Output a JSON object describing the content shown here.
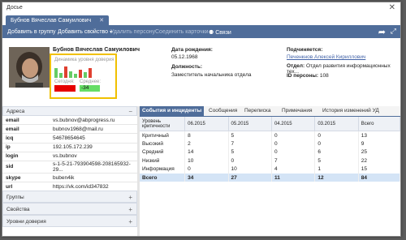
{
  "window": {
    "title": "Досье"
  },
  "tab": {
    "label": "Бубнов Вячеслав Самуилович"
  },
  "toolbar": {
    "add_group": "Добавить в группу",
    "add_property": "Добавить свойство",
    "delete_person": "Удалить персону",
    "merge_cards": "Соединить карточки",
    "links": "Связи"
  },
  "profile": {
    "name": "Бубнов Вячеслав Самуилович",
    "trust": {
      "title": "Динамика уровня доверия",
      "today_label": "Сегодня:",
      "avg_label": "Среднее:",
      "avg_value": "-34",
      "today_color": "#e60000",
      "avg_color": "#66dd66"
    },
    "birth_label": "Дата рождения:",
    "birth_value": "05.12.1968",
    "position_label": "Должность:",
    "position_value": "Заместитель начальника отдела",
    "subordinate_label": "Подчиняется:",
    "subordinate_value": "Печенкнов Алексей Кириллович",
    "dept_label": "Отдел:",
    "dept_value": "Отдел развития информационных тех...",
    "id_label": "ID персоны:",
    "id_value": "108"
  },
  "addresses": {
    "header": "Адреса",
    "rows": [
      {
        "k": "email",
        "v": "vs.bubnov@abprogress.ru"
      },
      {
        "k": "email",
        "v": "bubnov1968@mail.ru"
      },
      {
        "k": "icq",
        "v": "54678654645"
      },
      {
        "k": "ip",
        "v": "192.105.172.239"
      },
      {
        "k": "login",
        "v": "vs.bubnov"
      },
      {
        "k": "sid",
        "v": "s-1-5-21-793904598-208165932-29..."
      },
      {
        "k": "skype",
        "v": "buben4ik"
      },
      {
        "k": "url",
        "v": "https://vk.com/id347832"
      }
    ]
  },
  "sections": {
    "groups": "Группы",
    "properties": "Свойства",
    "trust_levels": "Уровни доверия"
  },
  "right_tabs": [
    "События и инциденты",
    "Сообщения",
    "Переписка",
    "Примечания",
    "История изменений УД"
  ],
  "events_table": {
    "headers": [
      "Уровень критичности",
      "06.2015",
      "05.2015",
      "04.2015",
      "03.2015",
      "Всего"
    ],
    "rows": [
      [
        "Критичный",
        "8",
        "5",
        "0",
        "0",
        "13"
      ],
      [
        "Высокий",
        "2",
        "7",
        "0",
        "0",
        "9"
      ],
      [
        "Средний",
        "14",
        "5",
        "0",
        "6",
        "25"
      ],
      [
        "Низкий",
        "10",
        "0",
        "7",
        "5",
        "22"
      ],
      [
        "Информация",
        "0",
        "10",
        "4",
        "1",
        "15"
      ]
    ],
    "total": [
      "Всего",
      "34",
      "27",
      "11",
      "12",
      "84"
    ]
  },
  "colors": {
    "accent": "#4f6d9a",
    "highlight": "#f0c000"
  }
}
